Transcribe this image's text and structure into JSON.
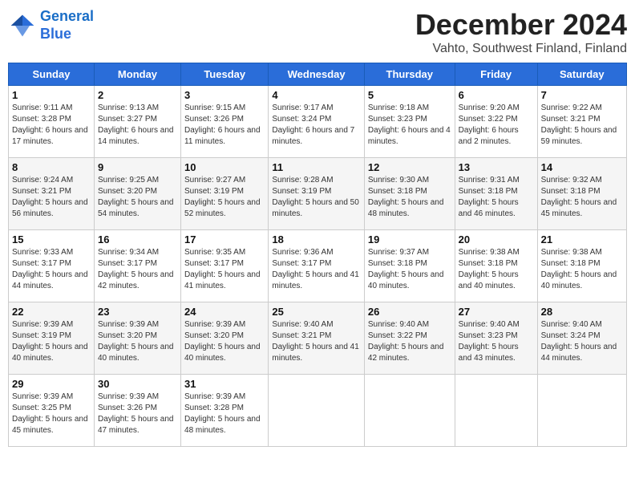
{
  "logo": {
    "line1": "General",
    "line2": "Blue"
  },
  "title": "December 2024",
  "location": "Vahto, Southwest Finland, Finland",
  "days_of_week": [
    "Sunday",
    "Monday",
    "Tuesday",
    "Wednesday",
    "Thursday",
    "Friday",
    "Saturday"
  ],
  "weeks": [
    [
      {
        "day": "1",
        "sunrise": "9:11 AM",
        "sunset": "3:28 PM",
        "daylight": "6 hours and 17 minutes."
      },
      {
        "day": "2",
        "sunrise": "9:13 AM",
        "sunset": "3:27 PM",
        "daylight": "6 hours and 14 minutes."
      },
      {
        "day": "3",
        "sunrise": "9:15 AM",
        "sunset": "3:26 PM",
        "daylight": "6 hours and 11 minutes."
      },
      {
        "day": "4",
        "sunrise": "9:17 AM",
        "sunset": "3:24 PM",
        "daylight": "6 hours and 7 minutes."
      },
      {
        "day": "5",
        "sunrise": "9:18 AM",
        "sunset": "3:23 PM",
        "daylight": "6 hours and 4 minutes."
      },
      {
        "day": "6",
        "sunrise": "9:20 AM",
        "sunset": "3:22 PM",
        "daylight": "6 hours and 2 minutes."
      },
      {
        "day": "7",
        "sunrise": "9:22 AM",
        "sunset": "3:21 PM",
        "daylight": "5 hours and 59 minutes."
      }
    ],
    [
      {
        "day": "8",
        "sunrise": "9:24 AM",
        "sunset": "3:21 PM",
        "daylight": "5 hours and 56 minutes."
      },
      {
        "day": "9",
        "sunrise": "9:25 AM",
        "sunset": "3:20 PM",
        "daylight": "5 hours and 54 minutes."
      },
      {
        "day": "10",
        "sunrise": "9:27 AM",
        "sunset": "3:19 PM",
        "daylight": "5 hours and 52 minutes."
      },
      {
        "day": "11",
        "sunrise": "9:28 AM",
        "sunset": "3:19 PM",
        "daylight": "5 hours and 50 minutes."
      },
      {
        "day": "12",
        "sunrise": "9:30 AM",
        "sunset": "3:18 PM",
        "daylight": "5 hours and 48 minutes."
      },
      {
        "day": "13",
        "sunrise": "9:31 AM",
        "sunset": "3:18 PM",
        "daylight": "5 hours and 46 minutes."
      },
      {
        "day": "14",
        "sunrise": "9:32 AM",
        "sunset": "3:18 PM",
        "daylight": "5 hours and 45 minutes."
      }
    ],
    [
      {
        "day": "15",
        "sunrise": "9:33 AM",
        "sunset": "3:17 PM",
        "daylight": "5 hours and 44 minutes."
      },
      {
        "day": "16",
        "sunrise": "9:34 AM",
        "sunset": "3:17 PM",
        "daylight": "5 hours and 42 minutes."
      },
      {
        "day": "17",
        "sunrise": "9:35 AM",
        "sunset": "3:17 PM",
        "daylight": "5 hours and 41 minutes."
      },
      {
        "day": "18",
        "sunrise": "9:36 AM",
        "sunset": "3:17 PM",
        "daylight": "5 hours and 41 minutes."
      },
      {
        "day": "19",
        "sunrise": "9:37 AM",
        "sunset": "3:18 PM",
        "daylight": "5 hours and 40 minutes."
      },
      {
        "day": "20",
        "sunrise": "9:38 AM",
        "sunset": "3:18 PM",
        "daylight": "5 hours and 40 minutes."
      },
      {
        "day": "21",
        "sunrise": "9:38 AM",
        "sunset": "3:18 PM",
        "daylight": "5 hours and 40 minutes."
      }
    ],
    [
      {
        "day": "22",
        "sunrise": "9:39 AM",
        "sunset": "3:19 PM",
        "daylight": "5 hours and 40 minutes."
      },
      {
        "day": "23",
        "sunrise": "9:39 AM",
        "sunset": "3:20 PM",
        "daylight": "5 hours and 40 minutes."
      },
      {
        "day": "24",
        "sunrise": "9:39 AM",
        "sunset": "3:20 PM",
        "daylight": "5 hours and 40 minutes."
      },
      {
        "day": "25",
        "sunrise": "9:40 AM",
        "sunset": "3:21 PM",
        "daylight": "5 hours and 41 minutes."
      },
      {
        "day": "26",
        "sunrise": "9:40 AM",
        "sunset": "3:22 PM",
        "daylight": "5 hours and 42 minutes."
      },
      {
        "day": "27",
        "sunrise": "9:40 AM",
        "sunset": "3:23 PM",
        "daylight": "5 hours and 43 minutes."
      },
      {
        "day": "28",
        "sunrise": "9:40 AM",
        "sunset": "3:24 PM",
        "daylight": "5 hours and 44 minutes."
      }
    ],
    [
      {
        "day": "29",
        "sunrise": "9:39 AM",
        "sunset": "3:25 PM",
        "daylight": "5 hours and 45 minutes."
      },
      {
        "day": "30",
        "sunrise": "9:39 AM",
        "sunset": "3:26 PM",
        "daylight": "5 hours and 47 minutes."
      },
      {
        "day": "31",
        "sunrise": "9:39 AM",
        "sunset": "3:28 PM",
        "daylight": "5 hours and 48 minutes."
      },
      null,
      null,
      null,
      null
    ]
  ]
}
